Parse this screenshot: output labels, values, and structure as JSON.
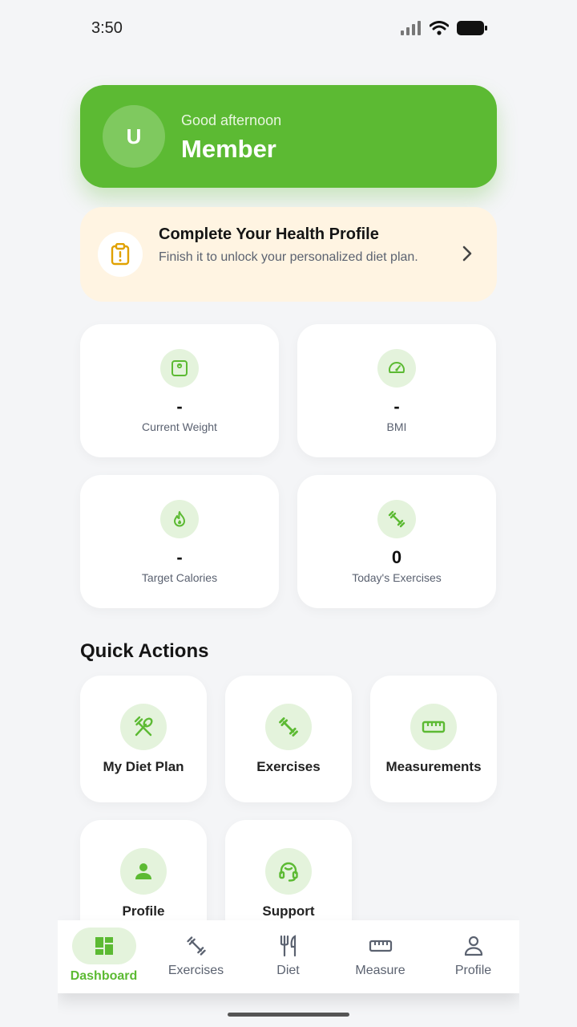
{
  "status_bar": {
    "time": "3:50"
  },
  "hero": {
    "avatar_initial": "U",
    "greeting": "Good afternoon",
    "name": "Member"
  },
  "profile_banner": {
    "title": "Complete Your Health Profile",
    "subtitle": "Finish it to unlock your personalized diet plan."
  },
  "stats": [
    {
      "value": "-",
      "label": "Current Weight",
      "icon": "scale-icon"
    },
    {
      "value": "-",
      "label": "BMI",
      "icon": "speedometer-icon"
    },
    {
      "value": "-",
      "label": "Target Calories",
      "icon": "flame-icon"
    },
    {
      "value": "0",
      "label": "Today's Exercises",
      "icon": "dumbbell-icon"
    }
  ],
  "quick_actions": {
    "title": "Quick Actions",
    "items": [
      {
        "label": "My Diet Plan",
        "icon": "utensils-icon"
      },
      {
        "label": "Exercises",
        "icon": "dumbbell-icon"
      },
      {
        "label": "Measurements",
        "icon": "ruler-icon"
      },
      {
        "label": "Profile",
        "icon": "person-icon"
      },
      {
        "label": "Support",
        "icon": "headset-icon"
      }
    ]
  },
  "bottom_nav": {
    "items": [
      {
        "label": "Dashboard",
        "icon": "dashboard-icon",
        "active": true
      },
      {
        "label": "Exercises",
        "icon": "dumbbell-icon",
        "active": false
      },
      {
        "label": "Diet",
        "icon": "fork-knife-icon",
        "active": false
      },
      {
        "label": "Measure",
        "icon": "ruler-icon",
        "active": false
      },
      {
        "label": "Profile",
        "icon": "person-icon",
        "active": false
      }
    ]
  },
  "colors": {
    "accent": "#5cba33",
    "accent_soft": "#e4f3dc",
    "banner_bg": "#fff4e2",
    "warning": "#e0a100"
  }
}
